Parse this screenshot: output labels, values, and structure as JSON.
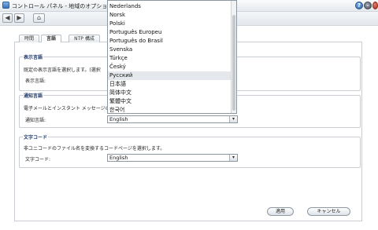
{
  "window": {
    "title": "コントロール パネル - 地域のオプション"
  },
  "tabs": [
    {
      "label": "時間"
    },
    {
      "label": "言語"
    },
    {
      "label": "NTP 構成"
    }
  ],
  "display_language": {
    "section_title": "表示言語",
    "description": "既定の表示言語を選択します。(選択",
    "field_label": "表示言語:"
  },
  "notification_language": {
    "section_title": "通知言語",
    "description": "電子メールとインスタント メッセージの",
    "field_label": "通知言語:",
    "selected": "English",
    "options": [
      "Nederlands",
      "Norsk",
      "Polski",
      "Português Europeu",
      "Português do Brasil",
      "Svenska",
      "Türkçe",
      "Český",
      "Русский",
      "日本語",
      "简体中文",
      "繁體中文",
      "한국어"
    ],
    "highlighted": "Русский"
  },
  "codepage": {
    "section_title": "文字コード",
    "description": "非ユニコードのファイル名を変換するコードページを選択します。",
    "field_label": "文字コード:",
    "selected": "English"
  },
  "buttons": {
    "apply": "適用",
    "cancel": "キャンセル"
  },
  "colors": {
    "accent": "#1f3b6e",
    "highlight": "#e4e7eb"
  }
}
